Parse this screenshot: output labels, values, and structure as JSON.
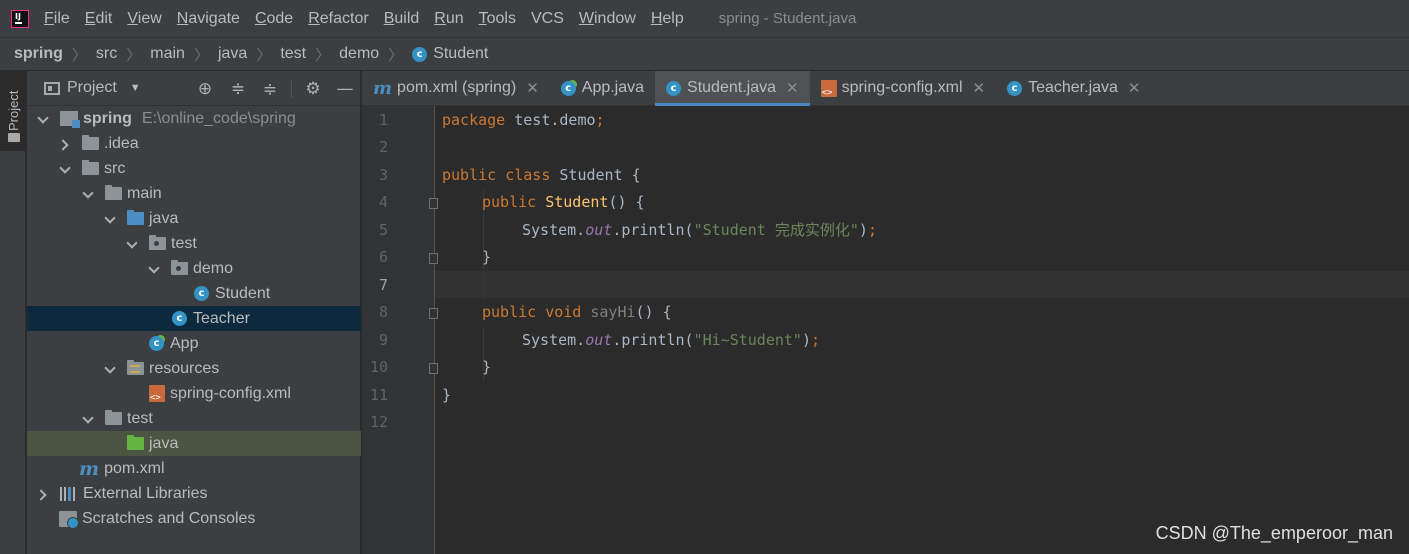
{
  "menubar": {
    "items": [
      {
        "label": "File",
        "mnemonic": "F",
        "rest": "ile"
      },
      {
        "label": "Edit",
        "mnemonic": "E",
        "rest": "dit"
      },
      {
        "label": "View",
        "mnemonic": "V",
        "rest": "iew"
      },
      {
        "label": "Navigate",
        "mnemonic": "N",
        "rest": "avigate"
      },
      {
        "label": "Code",
        "mnemonic": "C",
        "rest": "ode"
      },
      {
        "label": "Refactor",
        "mnemonic": "R",
        "rest": "efactor"
      },
      {
        "label": "Build",
        "mnemonic": "B",
        "rest": "uild"
      },
      {
        "label": "Run",
        "mnemonic": "R",
        "rest": "un",
        "pre": ""
      },
      {
        "label": "Tools",
        "mnemonic": "T",
        "rest": "ools"
      },
      {
        "label": "VCS",
        "mnemonic": "",
        "rest": "VCS"
      },
      {
        "label": "Window",
        "mnemonic": "W",
        "rest": "indow"
      },
      {
        "label": "Help",
        "mnemonic": "H",
        "rest": "elp"
      }
    ],
    "window_title": "spring - Student.java",
    "logo_text": "IJ"
  },
  "breadcrumb": [
    "spring",
    "src",
    "main",
    "java",
    "test",
    "demo",
    "Student"
  ],
  "toolstrip": {
    "project_label": "Project"
  },
  "project": {
    "title": "Project",
    "tree": [
      {
        "label": "spring",
        "extra": "E:\\online_code\\spring"
      },
      {
        "label": ".idea"
      },
      {
        "label": "src"
      },
      {
        "label": "main"
      },
      {
        "label": "java"
      },
      {
        "label": "test"
      },
      {
        "label": "demo"
      },
      {
        "label": "Student"
      },
      {
        "label": "Teacher"
      },
      {
        "label": "App"
      },
      {
        "label": "resources"
      },
      {
        "label": "spring-config.xml"
      },
      {
        "label": "test"
      },
      {
        "label": "java"
      },
      {
        "label": "pom.xml"
      },
      {
        "label": "External Libraries"
      },
      {
        "label": "Scratches and Consoles"
      }
    ]
  },
  "tabs": [
    {
      "label": "pom.xml (spring)"
    },
    {
      "label": "App.java"
    },
    {
      "label": "Student.java"
    },
    {
      "label": "spring-config.xml"
    },
    {
      "label": "Teacher.java"
    }
  ],
  "editor": {
    "line_numbers": [
      "1",
      "2",
      "3",
      "4",
      "5",
      "6",
      "7",
      "8",
      "9",
      "10",
      "11",
      "12"
    ],
    "code": {
      "l1_kw": "package",
      "l1_rest": " test.demo",
      "l1_semi": ";",
      "l3_kw1": "public",
      "l3_kw2": "class",
      "l3_rest": " Student {",
      "l4_kw": "public",
      "l4_name": "Student",
      "l4_rest": "() {",
      "l5_a": "System.",
      "l5_fld": "out",
      "l5_b": ".println(",
      "l5_str": "\"Student 完成实例化\"",
      "l5_c": ")",
      "l5_semi": ";",
      "l6": "}",
      "l8_kw1": "public",
      "l8_kw2": "void",
      "l8_name": "sayHi",
      "l8_rest": "() {",
      "l9_a": "System.",
      "l9_fld": "out",
      "l9_b": ".println(",
      "l9_str": "\"Hi~Student\"",
      "l9_c": ")",
      "l9_semi": ";",
      "l10": "}",
      "l11": "}"
    }
  },
  "watermark": "CSDN @The_emperoor_man",
  "colors": {
    "keyword": "#cc7832",
    "method_decl": "#ffc66d",
    "string": "#6a8759",
    "static_field": "#9876aa",
    "selection": "#0d293e",
    "tab_underline": "#4a88c7"
  }
}
